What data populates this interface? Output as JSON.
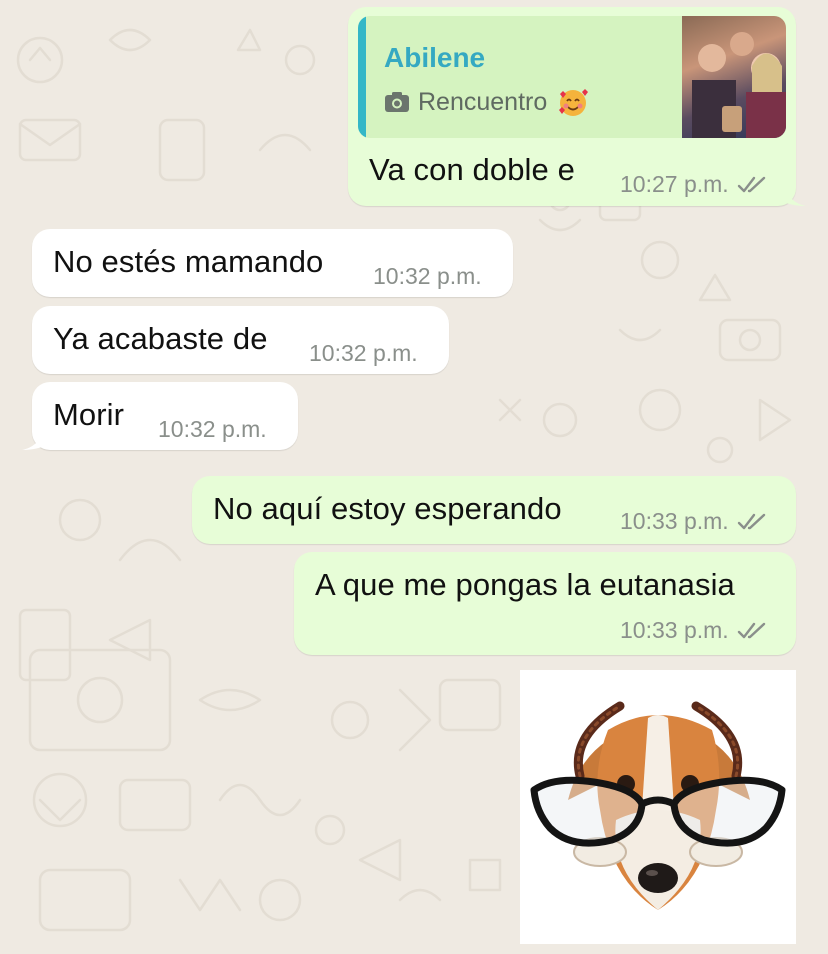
{
  "chat": {
    "quoted_message": {
      "author": "Abilene",
      "media_type": "Rencuentro",
      "emoji": "🥰",
      "reply_text": "Va con doble e",
      "time": "10:27 p.m."
    },
    "messages": [
      {
        "text": "No estés mamando",
        "time": "10:32 p.m."
      },
      {
        "text": "Ya acabaste de",
        "time": "10:32 p.m."
      },
      {
        "text": "Morir",
        "time": "10:32 p.m."
      },
      {
        "text": "No aquí estoy esperando",
        "time": "10:33 p.m."
      },
      {
        "text": "A que me pongas la eutanasia",
        "time": "10:33 p.m."
      }
    ],
    "sticker": {
      "description_icon": "dog-with-glasses-sticker"
    }
  },
  "colors": {
    "background": "#efeae2",
    "incoming_bubble": "#ffffff",
    "outgoing_bubble": "#e7fdd7",
    "quote_bar": "#34b7c7",
    "read_ticks": "#8a8f8b"
  }
}
